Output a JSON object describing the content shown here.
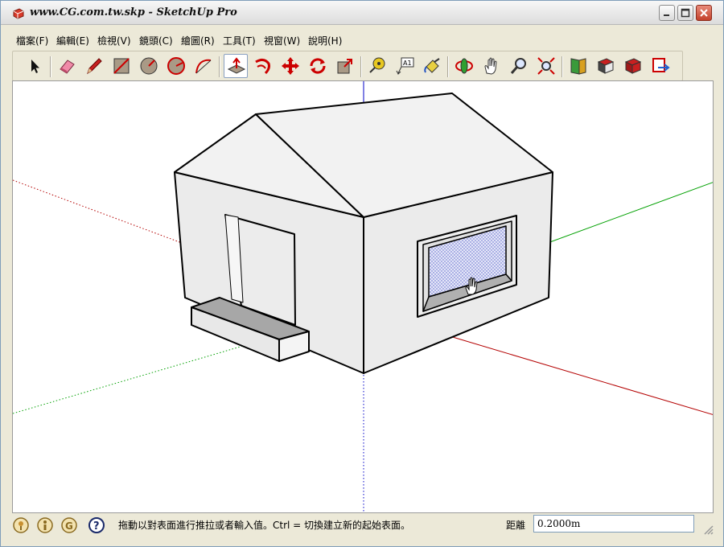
{
  "window": {
    "title": "www.CG.com.tw.skp - SketchUp Pro"
  },
  "menu": [
    {
      "label": "檔案(F)"
    },
    {
      "label": "編輯(E)"
    },
    {
      "label": "檢視(V)"
    },
    {
      "label": "鏡頭(C)"
    },
    {
      "label": "繪圖(R)"
    },
    {
      "label": "工具(T)"
    },
    {
      "label": "視窗(W)"
    },
    {
      "label": "說明(H)"
    }
  ],
  "toolbar": {
    "tools": [
      "select-icon",
      "eraser-icon",
      "pencil-icon",
      "rectangle-icon",
      "circle-icon",
      "polygon-icon",
      "arc-icon",
      "push-pull-icon",
      "follow-me-icon",
      "move-icon",
      "rotate-icon",
      "scale-icon",
      "tape-measure-icon",
      "text-icon",
      "paint-bucket-icon",
      "orbit-icon",
      "pan-icon",
      "zoom-icon",
      "zoom-extents-icon",
      "warehouse-icon",
      "components-icon",
      "share-model-icon",
      "export-icon"
    ],
    "active_tool": "push-pull-icon"
  },
  "status": {
    "message": "拖動以對表面進行推拉或者輸入值。Ctrl = 切換建立新的起始表面。",
    "vcb_label": "距離",
    "vcb_value": "0.2000m"
  },
  "colors": {
    "axis_red": "#b40000",
    "axis_green": "#00a000",
    "axis_blue": "#0000c8",
    "face_front": "#ebebeb",
    "face_roof": "#f2f2f2",
    "glass": "#d8dcf5"
  }
}
